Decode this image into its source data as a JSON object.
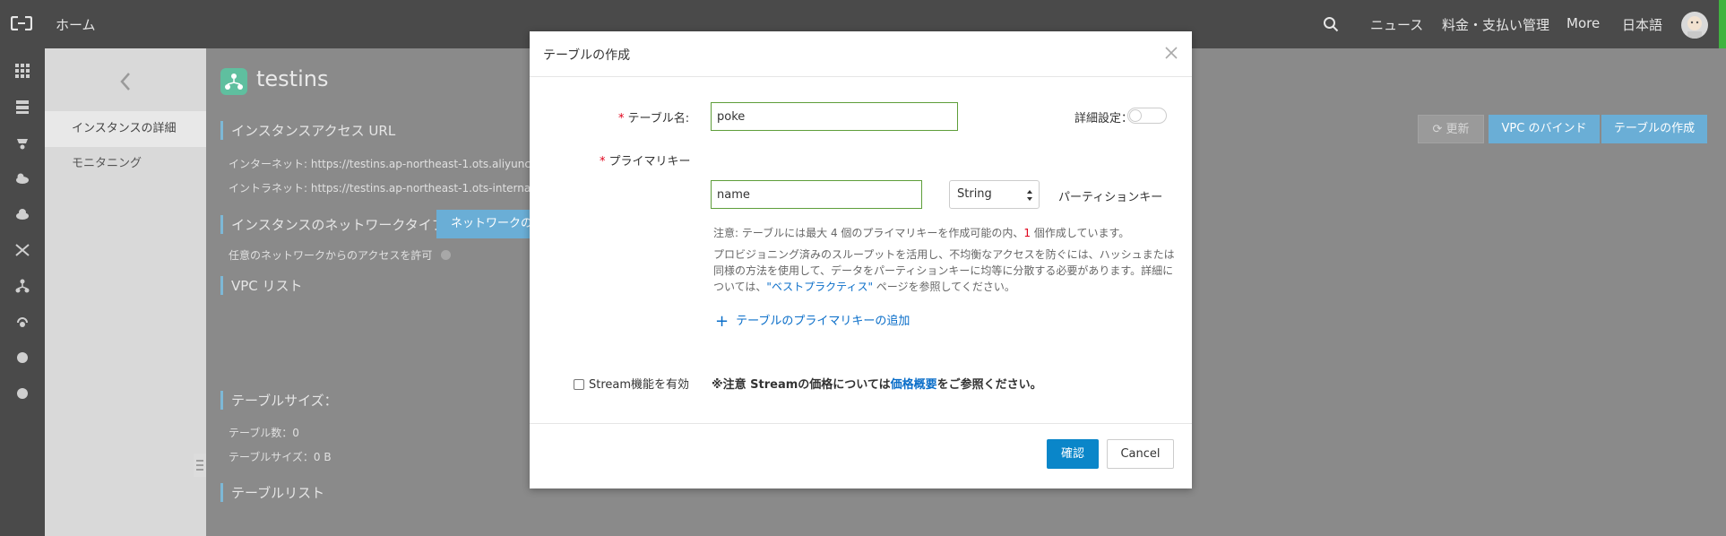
{
  "topbar": {
    "home": "ホーム",
    "nav": [
      "ニュース",
      "料金・支払い管理",
      "More",
      "日本語"
    ]
  },
  "subnav": {
    "items": [
      "インスタンスの詳細",
      "モニタニング"
    ]
  },
  "main": {
    "title": "testins",
    "access_url_header": "インスタンスアクセス URL",
    "internet_line": "インターネット: https://testins.ap-northeast-1.ots.aliyuncs",
    "intranet_line": "イントラネット: https://testins.ap-northeast-1.ots-interna",
    "network_type_header": "インスタンスのネットワークタイプ",
    "network_tag": "ネットワークの",
    "network_access_line": "任意のネットワークからのアクセスを許可",
    "vpc_list_header": "VPC リスト",
    "table_size_header": "テーブルサイズ：",
    "table_count_line": "テーブル数：0",
    "table_size_line": "テーブルサイズ：0 B",
    "table_list_header": "テーブルリスト",
    "buttons": {
      "refresh": "更新",
      "vpc_bind": "VPC のバインド",
      "create_table": "テーブルの作成"
    }
  },
  "modal": {
    "title": "テーブルの作成",
    "table_name_label": "テーブル名:",
    "table_name_value": "poke",
    "advanced_label": "詳細設定：",
    "primary_key_label": "プライマリキー",
    "pk_name_value": "name",
    "pk_type_value": "String",
    "partition_key_label": "パーティションキー",
    "note_prefix": "注意: テーブルには最大 4 個のプライマリキーを作成可能の内、",
    "note_count": "1",
    "note_suffix": " 個作成しています。",
    "note_body": "プロビジョニング済みのスループットを活用し、不均衡なアクセスを防ぐには、ハッシュまたは同様の方法を使用して、データをパーティションキーに均等に分散する必要があります。詳細については、",
    "note_link": "\"ベストプラクティス\"",
    "note_tail": " ページを参照してください。",
    "add_pk_link": "テーブルのプライマリキーの追加",
    "stream_label": "Stream機能を有効",
    "stream_note_prefix": "※注意 Streamの価格については",
    "stream_note_link": "価格概要",
    "stream_note_suffix": "をご参照ください。",
    "confirm": "確認",
    "cancel": "Cancel"
  },
  "colors": {
    "accent": "#0a86c9",
    "input_border": "#5e9e3a",
    "required": "#e0001a",
    "link": "#0a6ec9"
  }
}
